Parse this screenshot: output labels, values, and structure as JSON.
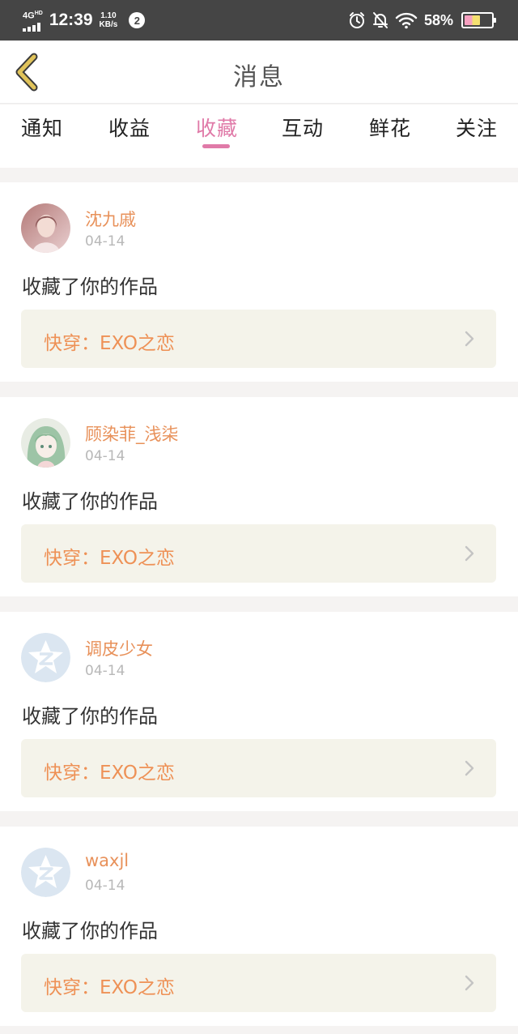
{
  "status_bar": {
    "network": "4G",
    "network_sup": "HD",
    "time": "12:39",
    "speed_value": "1.10",
    "speed_unit": "KB/s",
    "notification_count": "2",
    "battery_percent": "58%",
    "battery_level": 0.58
  },
  "header": {
    "title": "消息",
    "back_icon": "chevron-left-icon",
    "accent_color": "#e0c35a"
  },
  "tabs": [
    {
      "label": "通知",
      "active": false
    },
    {
      "label": "收益",
      "active": false
    },
    {
      "label": "收藏",
      "active": true
    },
    {
      "label": "互动",
      "active": false
    },
    {
      "label": "鲜花",
      "active": false
    },
    {
      "label": "关注",
      "active": false
    }
  ],
  "colors": {
    "active_tab": "#e07aa8",
    "username": "#e8915a",
    "work_title": "#ee9156",
    "work_bg": "#f4f3ea"
  },
  "messages": [
    {
      "username": "沈九戚",
      "date": "04-14",
      "action": "收藏了你的作品",
      "work_title": "快穿：EXO之恋",
      "avatar": "photo-avatar"
    },
    {
      "username": "顾染菲_浅柒",
      "date": "04-14",
      "action": "收藏了你的作品",
      "work_title": "快穿：EXO之恋",
      "avatar": "anime-avatar"
    },
    {
      "username": "调皮少女",
      "date": "04-14",
      "action": "收藏了你的作品",
      "work_title": "快穿：EXO之恋",
      "avatar": "default-avatar"
    },
    {
      "username": "waxjl",
      "date": "04-14",
      "action": "收藏了你的作品",
      "work_title": "快穿：EXO之恋",
      "avatar": "default-avatar"
    }
  ]
}
